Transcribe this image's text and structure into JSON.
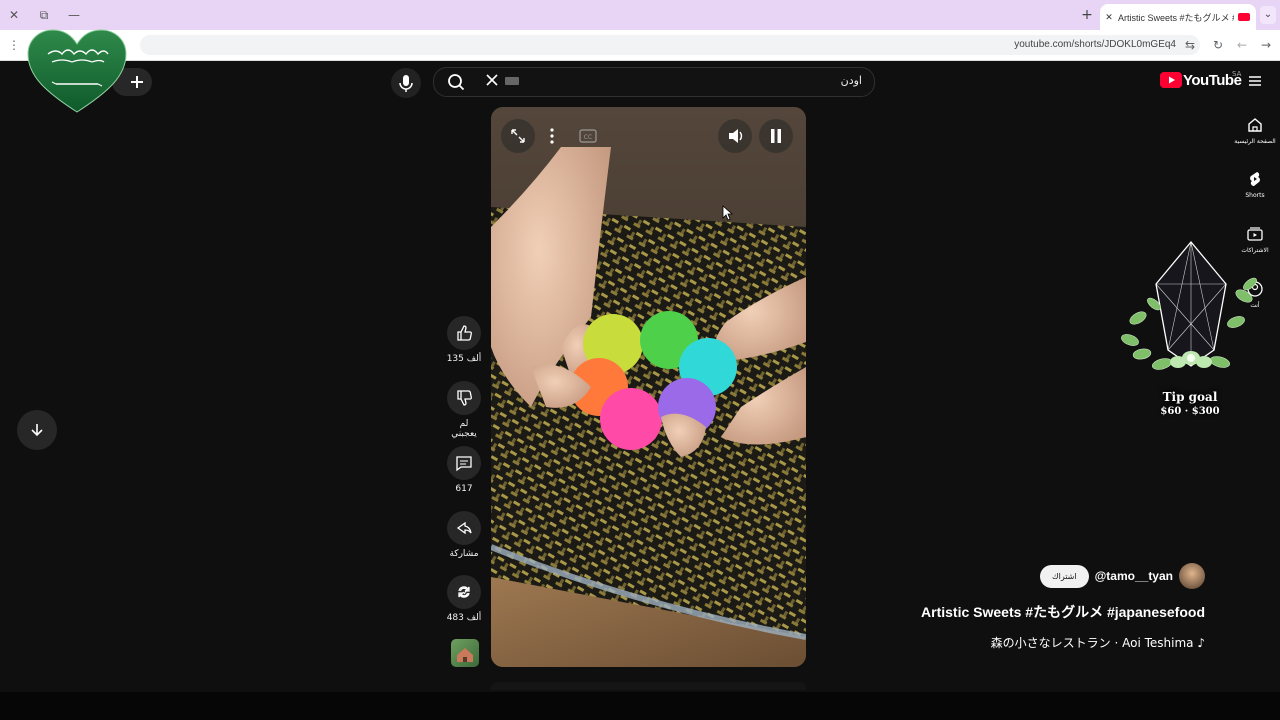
{
  "browser": {
    "tab_title": "Artistic Sweets #たもグルメ #",
    "tab_close": "✕",
    "new_tab": "+",
    "tab_menu": "⌄",
    "url": "youtube.com/shorts/JDOKL0mGEq4",
    "window_controls": [
      "✕",
      "⧉",
      "—"
    ],
    "accent": "#e8d5f5"
  },
  "header": {
    "search_value": "اودن",
    "logo_text": "YouTube",
    "region": "SA",
    "brand_color": "#ff0033"
  },
  "sidebar_right": [
    {
      "label": "الصفحة الرئيسية",
      "icon": "home-icon"
    },
    {
      "label": "Shorts",
      "icon": "shorts-icon"
    },
    {
      "label": "الاشتراكات",
      "icon": "subscriptions-icon"
    },
    {
      "label": "أنت",
      "icon": "account-icon"
    }
  ],
  "actions": {
    "like_count": "135 ألف",
    "dislike_label": "لم يعجبني",
    "comments_count": "617",
    "share_label": "مشاركة",
    "remix_count": "483 ألف"
  },
  "video": {
    "channel": "@tamo__tyan",
    "subscribe_label": "اشتراك",
    "title": "Artistic Sweets #たもグルメ #japanesefood",
    "music": "森の小さなレストラン · Aoi Teshima ♪"
  },
  "overlay": {
    "tip_title": "Tip goal",
    "tip_range": "$60 · $300"
  }
}
